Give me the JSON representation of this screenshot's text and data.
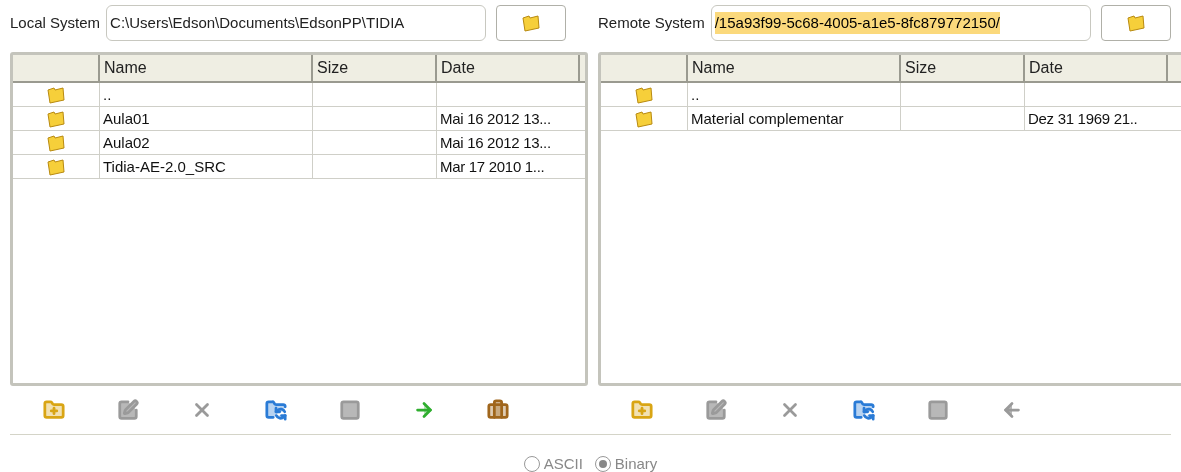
{
  "panels": [
    {
      "label": "Local System",
      "path": "C:\\Users\\Edson\\Documents\\EdsonPP\\TIDIA",
      "path_selected": false,
      "columns": [
        "Name",
        "Size",
        "Date"
      ],
      "rows": [
        {
          "name": ".."
        },
        {
          "name": "Aula01",
          "date": "Mai 16 2012 13..."
        },
        {
          "name": "Aula02",
          "date": "Mai 16 2012 13..."
        },
        {
          "name": "Tidia-AE-2.0_SRC",
          "date": "Mar 17 2010 1..."
        }
      ],
      "tools": [
        {
          "kind": "new-folder",
          "disabled": false
        },
        {
          "kind": "rename",
          "disabled": true
        },
        {
          "kind": "delete",
          "disabled": true
        },
        {
          "kind": "refresh",
          "disabled": false
        },
        {
          "kind": "properties",
          "disabled": true
        },
        {
          "kind": "upload",
          "disabled": false
        },
        {
          "kind": "archive",
          "disabled": false
        }
      ]
    },
    {
      "label": "Remote System",
      "path": "/15a93f99-5c68-4005-a1e5-8fc879772150/",
      "path_selected": true,
      "columns": [
        "Name",
        "Size",
        "Date"
      ],
      "rows": [
        {
          "name": ".."
        },
        {
          "name": "Material complementar",
          "date": "Dez 31 1969 21.."
        }
      ],
      "tools": [
        {
          "kind": "new-folder",
          "disabled": false
        },
        {
          "kind": "rename",
          "disabled": true
        },
        {
          "kind": "delete",
          "disabled": true
        },
        {
          "kind": "refresh",
          "disabled": false
        },
        {
          "kind": "properties",
          "disabled": true
        },
        {
          "kind": "download",
          "disabled": true
        }
      ]
    }
  ],
  "transfer_modes": [
    {
      "label": "ASCII",
      "selected": false
    },
    {
      "label": "Binary",
      "selected": true
    }
  ]
}
